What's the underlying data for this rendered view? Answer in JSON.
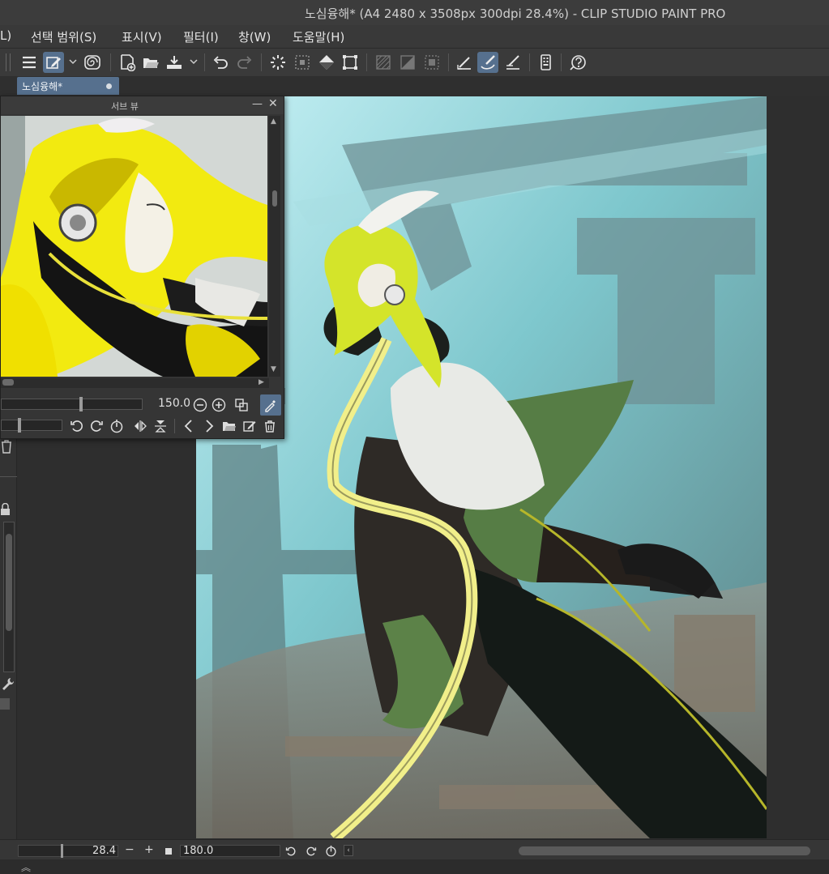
{
  "window": {
    "title": "노심융해* (A4 2480 x 3508px 300dpi 28.4%)  - CLIP STUDIO PAINT PRO"
  },
  "menu": {
    "items": [
      {
        "label": "L)"
      },
      {
        "label": "선택 범위(S)"
      },
      {
        "label": "표시(V)"
      },
      {
        "label": "필터(I)"
      },
      {
        "label": "창(W)"
      },
      {
        "label": "도움말(H)"
      }
    ]
  },
  "toolbar": {
    "icons": [
      "menu-icon",
      "edit-icon",
      "spiral-icon",
      "new-file-icon",
      "open-folder-icon",
      "save-icon",
      "undo-icon",
      "redo-icon",
      "loading-icon",
      "deselect-icon",
      "fill-icon",
      "transform-icon",
      "hatch-icon",
      "half-icon",
      "frame-icon",
      "ruler-icon",
      "brush-icon",
      "pen-icon",
      "phone-icon",
      "help-icon"
    ],
    "accent": "#56708e"
  },
  "tab": {
    "label": "노심융해*"
  },
  "subview": {
    "title": "서브 뷰",
    "zoom_value": "150.0"
  },
  "status": {
    "zoom": "28.4",
    "rotation": "180.0"
  }
}
